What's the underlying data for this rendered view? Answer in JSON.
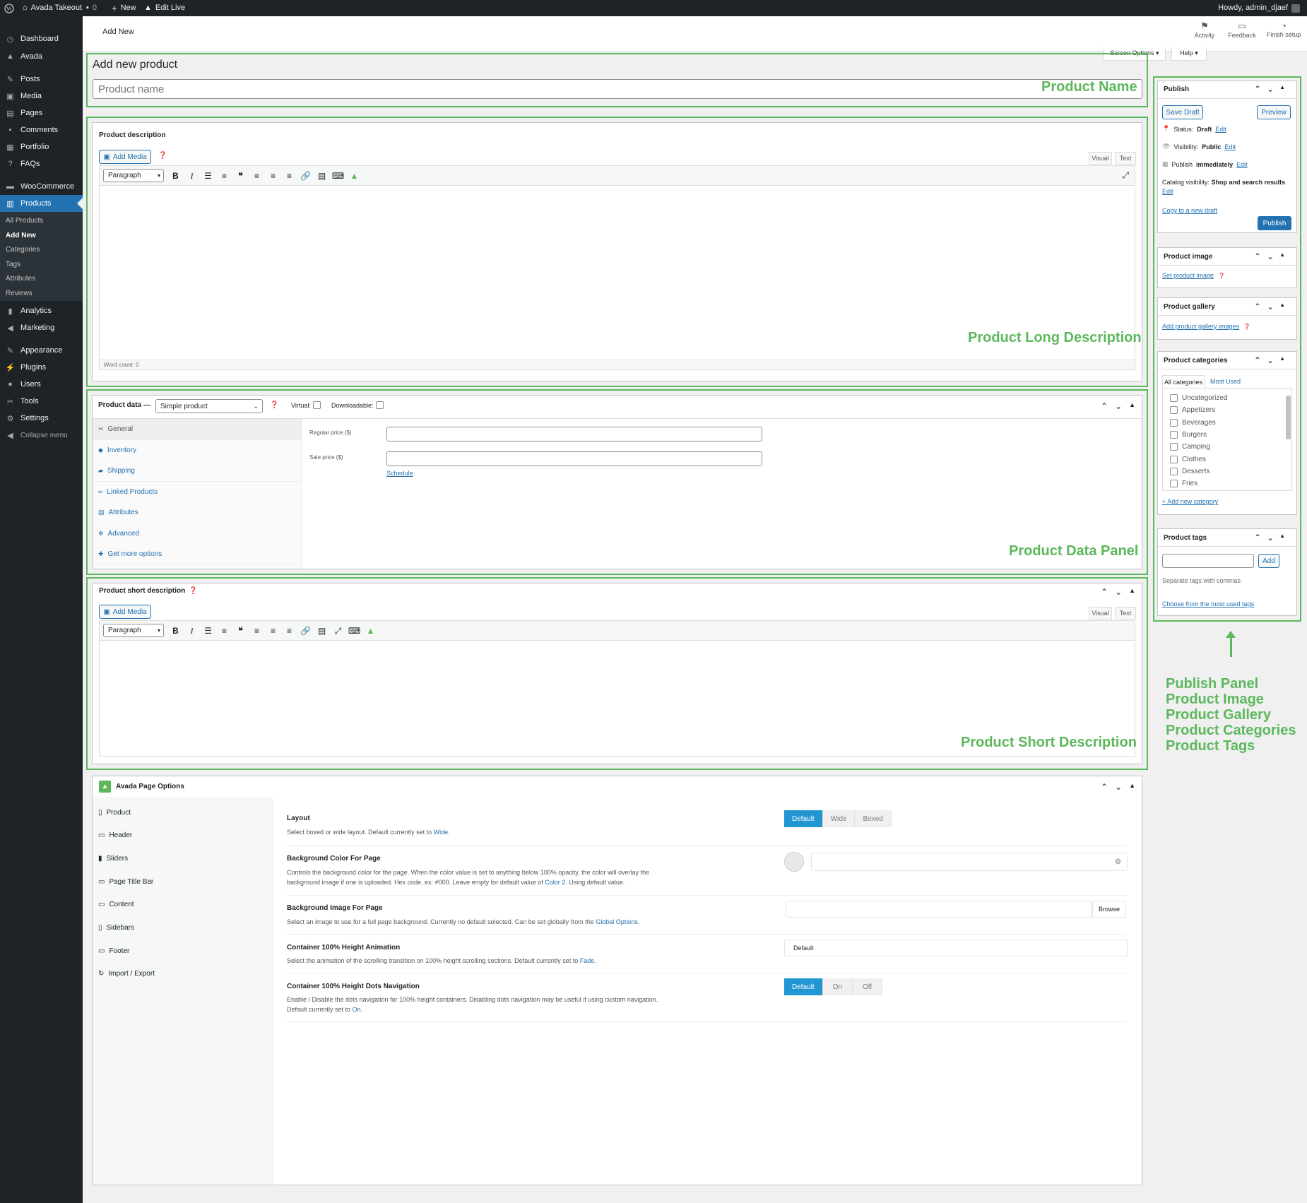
{
  "adminbar": {
    "site": "Avada Takeout",
    "comments": "0",
    "new": "New",
    "edit_live": "Edit Live",
    "howdy": "Howdy, admin_djaef"
  },
  "sidebar": {
    "items": [
      {
        "label": "Dashboard",
        "icon": "gauge-icon"
      },
      {
        "label": "Avada",
        "icon": "avada-icon"
      },
      {
        "label": "Posts",
        "icon": "pin-icon"
      },
      {
        "label": "Media",
        "icon": "media-icon"
      },
      {
        "label": "Pages",
        "icon": "pages-icon"
      },
      {
        "label": "Comments",
        "icon": "comment-icon"
      },
      {
        "label": "Portfolio",
        "icon": "portfolio-icon"
      },
      {
        "label": "FAQs",
        "icon": "help-icon"
      },
      {
        "label": "WooCommerce",
        "icon": "woo-icon"
      },
      {
        "label": "Products",
        "icon": "archive-icon"
      },
      {
        "label": "Analytics",
        "icon": "chart-icon"
      },
      {
        "label": "Marketing",
        "icon": "megaphone-icon"
      },
      {
        "label": "Appearance",
        "icon": "brush-icon"
      },
      {
        "label": "Plugins",
        "icon": "plug-icon"
      },
      {
        "label": "Users",
        "icon": "user-icon"
      },
      {
        "label": "Tools",
        "icon": "wrench-icon"
      },
      {
        "label": "Settings",
        "icon": "settings-icon"
      },
      {
        "label": "Collapse menu",
        "icon": "collapse-icon"
      }
    ],
    "submenu": [
      "All Products",
      "Add New",
      "Categories",
      "Tags",
      "Attributes",
      "Reviews"
    ]
  },
  "topbar": {
    "title": "Add New",
    "activity": "Activity",
    "feedback": "Feedback",
    "finish_setup": "Finish setup",
    "screen_options": "Screen Options ▾",
    "help": "Help ▾"
  },
  "main": {
    "heading": "Add new product",
    "product_name_placeholder": "Product name",
    "description_label": "Product description",
    "add_media": "Add Media",
    "visual": "Visual",
    "text": "Text",
    "paragraph": "Paragraph",
    "word_count": "Word count: 0",
    "product_data_label": "Product data —",
    "product_type": "Simple product",
    "virtual": "Virtual:",
    "downloadable": "Downloadable:",
    "pd_tabs": [
      {
        "label": "General",
        "icon": "wrench-icon"
      },
      {
        "label": "Inventory",
        "icon": "tag-icon"
      },
      {
        "label": "Shipping",
        "icon": "truck-icon"
      },
      {
        "label": "Linked Products",
        "icon": "link-icon"
      },
      {
        "label": "Attributes",
        "icon": "table-icon"
      },
      {
        "label": "Advanced",
        "icon": "gear-icon"
      },
      {
        "label": "Get more options",
        "icon": "plugin-icon"
      }
    ],
    "regular_price": "Regular price ($)",
    "sale_price": "Sale price ($)",
    "schedule": "Schedule",
    "short_description_label": "Product short description"
  },
  "annotations": {
    "product_name": "Product Name",
    "long_description": "Product Long Description",
    "data_panel": "Product Data Panel",
    "short_description": "Product Short Description",
    "right_list": [
      "Publish Panel",
      "Product Image",
      "Product Gallery",
      "Product Categories",
      "Product Tags"
    ]
  },
  "publish": {
    "title": "Publish",
    "save_draft": "Save Draft",
    "preview": "Preview",
    "status_label": "Status:",
    "status_value": "Draft",
    "visibility_label": "Visibility:",
    "visibility_value": "Public",
    "publish_label": "Publish",
    "publish_value": "immediately",
    "edit": "Edit",
    "catalog_label": "Catalog visibility:",
    "catalog_value": "Shop and search results",
    "copy_draft": "Copy to a new draft",
    "publish_btn": "Publish"
  },
  "product_image": {
    "title": "Product image",
    "link": "Set product image"
  },
  "product_gallery": {
    "title": "Product gallery",
    "link": "Add product gallery images"
  },
  "categories": {
    "title": "Product categories",
    "tab_all": "All categories",
    "tab_used": "Most Used",
    "items": [
      "Uncategorized",
      "Appetizers",
      "Beverages",
      "Burgers",
      "Camping",
      "Clothes",
      "Desserts",
      "Fries"
    ],
    "add_new": "+ Add new category"
  },
  "tags": {
    "title": "Product tags",
    "add": "Add",
    "hint": "Separate tags with commas",
    "choose": "Choose from the most used tags"
  },
  "avada": {
    "title": "Avada Page Options",
    "tabs": [
      {
        "label": "Product",
        "icon": "doc-icon"
      },
      {
        "label": "Header",
        "icon": "header-icon"
      },
      {
        "label": "Sliders",
        "icon": "slider-icon"
      },
      {
        "label": "Page Title Bar",
        "icon": "titlebar-icon"
      },
      {
        "label": "Content",
        "icon": "content-icon"
      },
      {
        "label": "Sidebars",
        "icon": "sidebar-icon"
      },
      {
        "label": "Footer",
        "icon": "footer-icon"
      },
      {
        "label": "Import / Export",
        "icon": "sync-icon"
      }
    ],
    "opt_layout_title": "Layout",
    "opt_layout_desc": "Select boxed or wide layout. Default currently set to",
    "opt_layout_link": "Wide.",
    "layout_options": [
      "Default",
      "Wide",
      "Boxed"
    ],
    "opt_bgcolor_title": "Background Color For Page",
    "opt_bgcolor_desc": "Controls the background color for the page. When the color value is set to anything below 100% opacity, the color will overlay the background image if one is uploaded. Hex code, ex: #000. Leave empty for default value of",
    "opt_bgcolor_link": "Color 2.",
    "opt_bgcolor_tail": "Using default value.",
    "opt_bgimage_title": "Background Image For Page",
    "opt_bgimage_desc": "Select an image to use for a full page background. Currently no default selected. Can be set globally from the",
    "opt_bgimage_link": "Global Options.",
    "browse": "Browse",
    "opt_anim_title": "Container 100% Height Animation",
    "opt_anim_desc": "Select the animation of the scrolling transition on 100% height scrolling sections. Default currently set to",
    "opt_anim_link": "Fade.",
    "anim_value": "Default",
    "opt_dots_title": "Container 100% Height Dots Navigation",
    "opt_dots_desc": "Enable / Disable the dots navigation for 100% height containers. Disabling dots navigation may be useful if using custom navigation. Default currently set to",
    "opt_dots_link": "On.",
    "dots_options": [
      "Default",
      "On",
      "Off"
    ]
  },
  "colors": {
    "accent": "#2271b1",
    "annotation": "#5cb85c",
    "admin_dark": "#1d2327",
    "avada_blue": "#2196d3"
  }
}
